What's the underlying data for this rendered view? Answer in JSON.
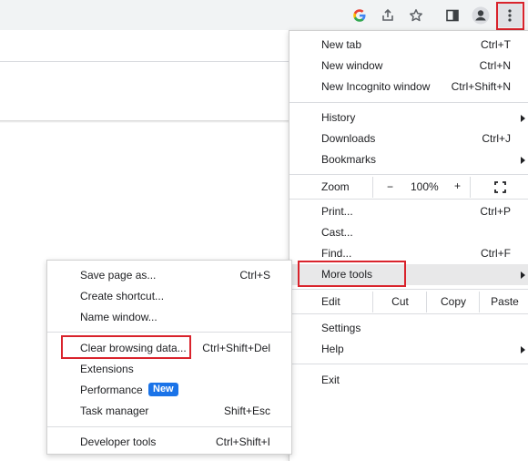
{
  "toolbar": {
    "icons": [
      "google-icon",
      "share-icon",
      "bookmark-star-icon",
      "side-panel-icon",
      "profile-avatar-icon",
      "more-menu-icon"
    ]
  },
  "main_menu": {
    "new_tab": {
      "label": "New tab",
      "shortcut": "Ctrl+T"
    },
    "new_window": {
      "label": "New window",
      "shortcut": "Ctrl+N"
    },
    "new_incognito": {
      "label": "New Incognito window",
      "shortcut": "Ctrl+Shift+N"
    },
    "history": {
      "label": "History"
    },
    "downloads": {
      "label": "Downloads",
      "shortcut": "Ctrl+J"
    },
    "bookmarks": {
      "label": "Bookmarks"
    },
    "zoom": {
      "label": "Zoom",
      "minus": "−",
      "value": "100%",
      "plus": "+"
    },
    "print": {
      "label": "Print...",
      "shortcut": "Ctrl+P"
    },
    "cast": {
      "label": "Cast..."
    },
    "find": {
      "label": "Find...",
      "shortcut": "Ctrl+F"
    },
    "more_tools": {
      "label": "More tools"
    },
    "edit": {
      "label": "Edit",
      "cut": "Cut",
      "copy": "Copy",
      "paste": "Paste"
    },
    "settings": {
      "label": "Settings"
    },
    "help": {
      "label": "Help"
    },
    "exit": {
      "label": "Exit"
    }
  },
  "sub_menu": {
    "save_page": {
      "label": "Save page as...",
      "shortcut": "Ctrl+S"
    },
    "create_shortcut": {
      "label": "Create shortcut..."
    },
    "name_window": {
      "label": "Name window..."
    },
    "clear_data": {
      "label": "Clear browsing data...",
      "shortcut": "Ctrl+Shift+Del"
    },
    "extensions": {
      "label": "Extensions"
    },
    "performance": {
      "label": "Performance",
      "badge": "New"
    },
    "task_manager": {
      "label": "Task manager",
      "shortcut": "Shift+Esc"
    },
    "developer_tools": {
      "label": "Developer tools",
      "shortcut": "Ctrl+Shift+I"
    }
  },
  "colors": {
    "highlight_box": "#d9232c",
    "badge": "#1a73e8",
    "hover": "#e8e8e9"
  }
}
